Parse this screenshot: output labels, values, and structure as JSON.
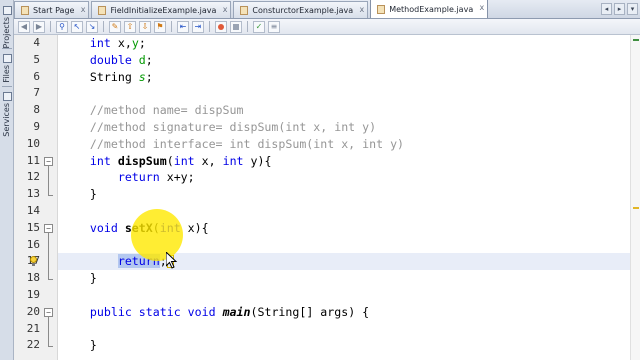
{
  "side_panel": {
    "tabs": [
      {
        "label": "Projects",
        "icon": "projects-icon"
      },
      {
        "label": "Files",
        "icon": "files-icon"
      },
      {
        "label": "Services",
        "icon": "services-icon"
      }
    ]
  },
  "tabs": [
    {
      "label": "Start Page",
      "active": false,
      "close": "x"
    },
    {
      "label": "FieldInitializeExample.java",
      "active": false,
      "close": "x"
    },
    {
      "label": "ConsturctorExample.java",
      "active": false,
      "close": "x"
    },
    {
      "label": "MethodExample.java",
      "active": true,
      "close": "x"
    }
  ],
  "tab_nav": {
    "left": "◂",
    "right": "▸",
    "menu": "▾"
  },
  "toolbar": {
    "buttons": [
      {
        "name": "back-icon",
        "glyph": "◀",
        "tone": "gray"
      },
      {
        "name": "forward-icon",
        "glyph": "▶",
        "tone": "gray"
      },
      {
        "name": "find-icon",
        "glyph": "⚲",
        "tone": "blue"
      },
      {
        "name": "find-previous-icon",
        "glyph": "↖",
        "tone": "blue"
      },
      {
        "name": "find-next-icon",
        "glyph": "↘",
        "tone": "blue"
      },
      {
        "name": "toggle-highlight-icon",
        "glyph": "✎",
        "tone": "orange"
      },
      {
        "name": "previous-bookmark-icon",
        "glyph": "⇧",
        "tone": "orange"
      },
      {
        "name": "next-bookmark-icon",
        "glyph": "⇩",
        "tone": "orange"
      },
      {
        "name": "toggle-bookmark-icon",
        "glyph": "⚑",
        "tone": "orange"
      },
      {
        "name": "shift-left-icon",
        "glyph": "⇤",
        "tone": "blue"
      },
      {
        "name": "shift-right-icon",
        "glyph": "⇥",
        "tone": "blue"
      },
      {
        "name": "start-macro-icon",
        "glyph": "",
        "tone": "dot"
      },
      {
        "name": "stop-macro-icon",
        "glyph": "",
        "tone": "sq"
      },
      {
        "name": "comment-icon",
        "glyph": "✓",
        "tone": "green"
      },
      {
        "name": "uncomment-icon",
        "glyph": "≡",
        "tone": "gray"
      }
    ]
  },
  "editor": {
    "first_line": 4,
    "current_line": 17,
    "lines": [
      {
        "n": "4",
        "indent": "    ",
        "tokens": [
          [
            "kw",
            "int"
          ],
          [
            "p",
            " x,"
          ],
          [
            "fld",
            "y"
          ],
          [
            "p",
            ";"
          ]
        ]
      },
      {
        "n": "5",
        "indent": "    ",
        "tokens": [
          [
            "kw",
            "double"
          ],
          [
            "p",
            " "
          ],
          [
            "fld",
            "d"
          ],
          [
            "p",
            ";"
          ]
        ]
      },
      {
        "n": "6",
        "indent": "    ",
        "tokens": [
          [
            "p",
            "String "
          ],
          [
            "fldi",
            "s"
          ],
          [
            "p",
            ";"
          ]
        ]
      },
      {
        "n": "7",
        "indent": "",
        "tokens": []
      },
      {
        "n": "8",
        "indent": "    ",
        "tokens": [
          [
            "cm",
            "//method name= dispSum"
          ]
        ]
      },
      {
        "n": "9",
        "indent": "    ",
        "tokens": [
          [
            "cm",
            "//method signature= dispSum(int x, int y)"
          ]
        ]
      },
      {
        "n": "10",
        "indent": "    ",
        "tokens": [
          [
            "cm",
            "//method interface= int dispSum(int x, int y)"
          ]
        ]
      },
      {
        "n": "11",
        "indent": "    ",
        "tokens": [
          [
            "kw",
            "int"
          ],
          [
            "p",
            " "
          ],
          [
            "mth",
            "dispSum"
          ],
          [
            "p",
            "("
          ],
          [
            "kw",
            "int"
          ],
          [
            "p",
            " x, "
          ],
          [
            "kw",
            "int"
          ],
          [
            "p",
            " y){"
          ]
        ]
      },
      {
        "n": "12",
        "indent": "        ",
        "tokens": [
          [
            "kw",
            "return"
          ],
          [
            "p",
            " x+y;"
          ]
        ]
      },
      {
        "n": "13",
        "indent": "    ",
        "tokens": [
          [
            "p",
            "}"
          ]
        ]
      },
      {
        "n": "14",
        "indent": "",
        "tokens": []
      },
      {
        "n": "15",
        "indent": "    ",
        "tokens": [
          [
            "kw",
            "void"
          ],
          [
            "p",
            " "
          ],
          [
            "mth",
            "setX"
          ],
          [
            "p",
            "("
          ],
          [
            "kw",
            "int"
          ],
          [
            "p",
            " x){"
          ]
        ]
      },
      {
        "n": "16",
        "indent": "",
        "tokens": []
      },
      {
        "n": "17",
        "indent": "        ",
        "tokens": [
          [
            "sel",
            "return"
          ],
          [
            "p",
            ";"
          ]
        ]
      },
      {
        "n": "18",
        "indent": "    ",
        "tokens": [
          [
            "p",
            "}"
          ]
        ]
      },
      {
        "n": "19",
        "indent": "",
        "tokens": []
      },
      {
        "n": "20",
        "indent": "    ",
        "tokens": [
          [
            "kw",
            "public"
          ],
          [
            "p",
            " "
          ],
          [
            "kw",
            "static"
          ],
          [
            "p",
            " "
          ],
          [
            "kw",
            "void"
          ],
          [
            "p",
            " "
          ],
          [
            "mthi",
            "main"
          ],
          [
            "p",
            "(String[] args) {"
          ]
        ]
      },
      {
        "n": "21",
        "indent": "",
        "tokens": []
      },
      {
        "n": "22",
        "indent": "    ",
        "tokens": [
          [
            "p",
            "}"
          ]
        ]
      }
    ],
    "folds": [
      {
        "start": "11",
        "end": "13"
      },
      {
        "start": "15",
        "end": "18"
      },
      {
        "start": "20",
        "end": "22"
      }
    ],
    "hint_line": "17"
  },
  "colors": {
    "keyword": "#0000e6",
    "comment": "#969696",
    "field": "#009900",
    "current_line": "#e8edf8",
    "selection": "#b4c8f0",
    "cursor_halo": "#ffe800"
  }
}
